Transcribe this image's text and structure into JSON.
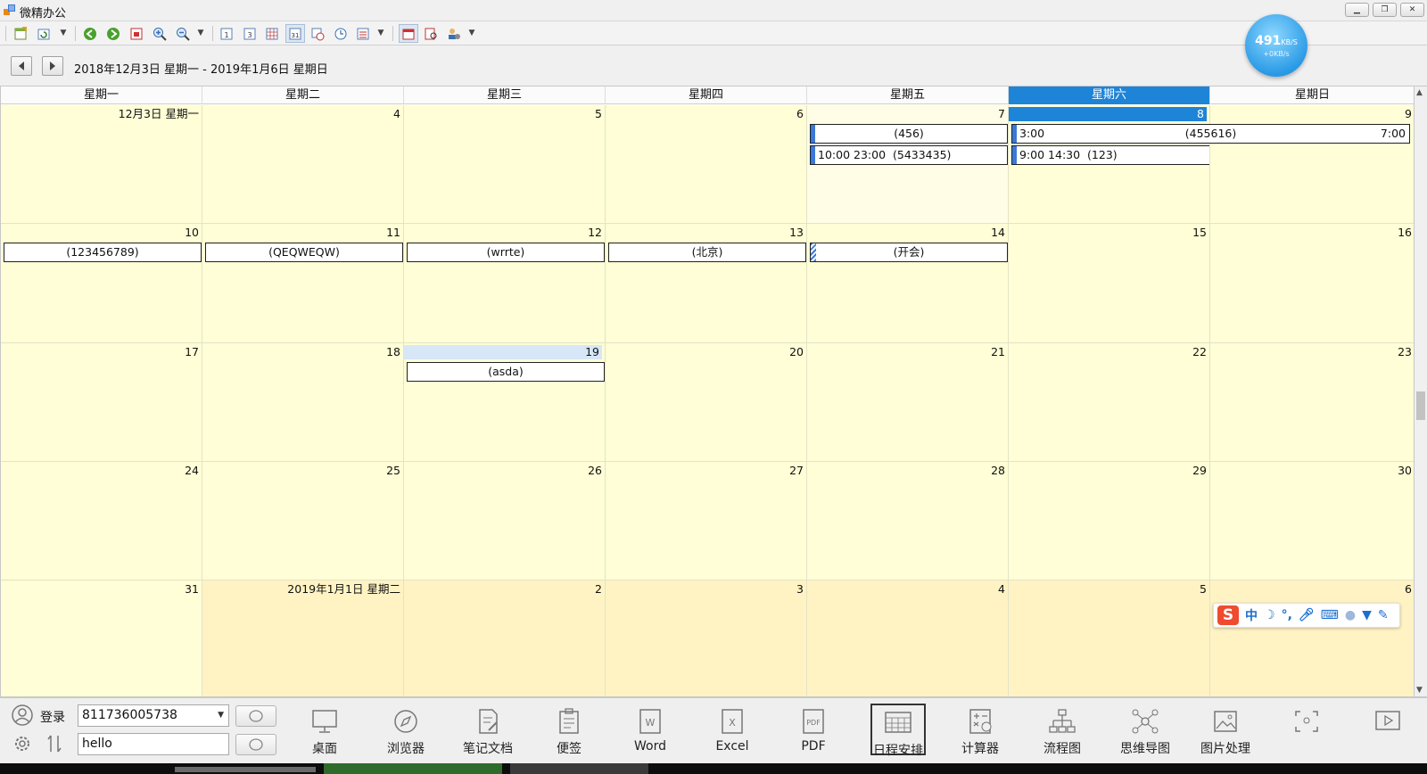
{
  "window": {
    "title": "微精办公"
  },
  "speed": {
    "value": "491",
    "unit": "KB/S",
    "up": "+0KB/s"
  },
  "nav": {
    "range": "2018年12月3日 星期一 - 2019年1月6日 星期日"
  },
  "weekdays": [
    "星期一",
    "星期二",
    "星期三",
    "星期四",
    "星期五",
    "星期六",
    "星期日"
  ],
  "weeks": [
    [
      "12月3日 星期一",
      "4",
      "5",
      "6",
      "7",
      "8",
      "9"
    ],
    [
      "10",
      "11",
      "12",
      "13",
      "14",
      "15",
      "16"
    ],
    [
      "17",
      "18",
      "19",
      "20",
      "21",
      "22",
      "23"
    ],
    [
      "24",
      "25",
      "26",
      "27",
      "28",
      "29",
      "30"
    ],
    [
      "31",
      "2019年1月1日 星期二",
      "2",
      "3",
      "4",
      "5",
      "6"
    ]
  ],
  "appointments": [
    {
      "text": "(456)"
    },
    {
      "start": "3:00",
      "text": "(455616)",
      "end": "7:00"
    },
    {
      "time": "10:00  23:00",
      "text": "(5433435)"
    },
    {
      "time": "9:00  14:30",
      "text": "(123)"
    },
    {
      "text": "(123456789)"
    },
    {
      "text": "(QEQWEQW)"
    },
    {
      "text": "(wrrte)"
    },
    {
      "text": "(北京)"
    },
    {
      "text": "(开会)"
    },
    {
      "text": "(asda)"
    }
  ],
  "ime": {
    "logo": "S",
    "lang": "中"
  },
  "bottom": {
    "login": "登录",
    "account": "811736005738",
    "search_text": "hello",
    "apps": [
      "桌面",
      "浏览器",
      "笔记文档",
      "便签",
      "Word",
      "Excel",
      "PDF",
      "日程安排",
      "计算器",
      "流程图",
      "思维导图",
      "图片处理",
      "",
      ""
    ]
  }
}
